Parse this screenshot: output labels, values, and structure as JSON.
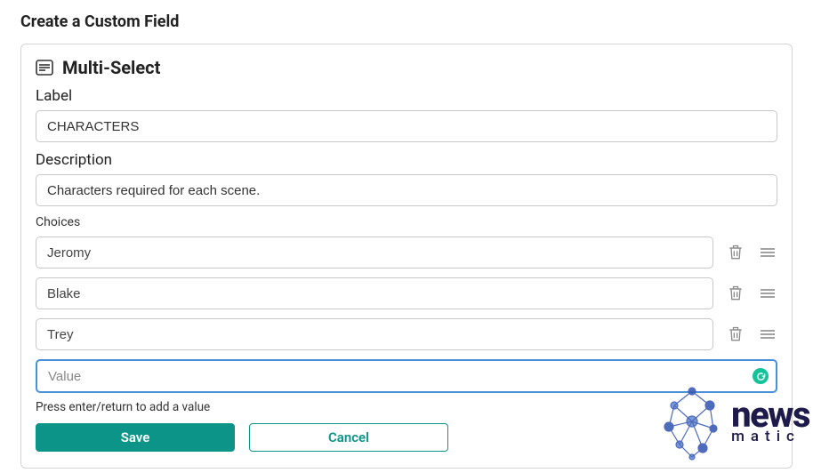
{
  "page": {
    "title": "Create a Custom Field"
  },
  "panel": {
    "title": "Multi-Select"
  },
  "form": {
    "label_field": {
      "label": "Label",
      "value": "CHARACTERS"
    },
    "description_field": {
      "label": "Description",
      "value": "Characters required for each scene."
    },
    "choices": {
      "label": "Choices",
      "items": [
        {
          "value": "Jeromy"
        },
        {
          "value": "Blake"
        },
        {
          "value": "Trey"
        }
      ],
      "new_value_placeholder": "Value",
      "helper": "Press enter/return to add a value"
    },
    "buttons": {
      "save": "Save",
      "cancel": "Cancel"
    }
  },
  "watermark": {
    "brand_main": "news",
    "brand_sub": "matic"
  }
}
